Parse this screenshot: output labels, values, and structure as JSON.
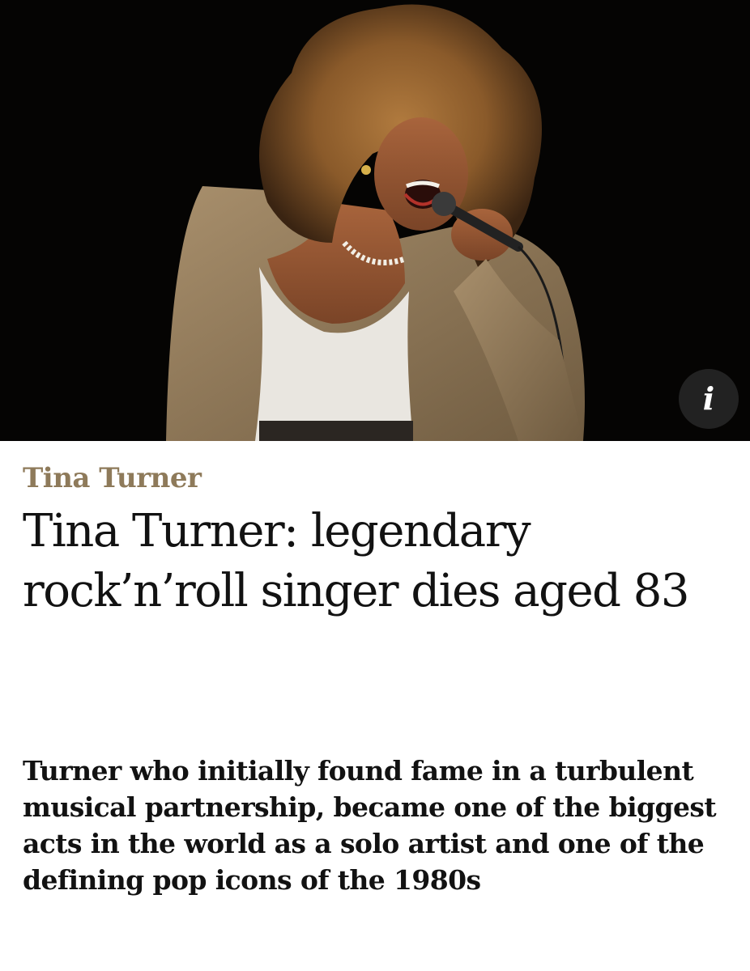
{
  "hero": {
    "info_label": "i"
  },
  "article": {
    "kicker": "Tina Turner",
    "headline": "Tina Turner: legendary rock’n’roll singer dies aged 83",
    "standfirst": "Turner who initially found fame in a turbulent musical partnership, became one of the biggest acts in the world as a solo artist and one of the defining pop icons of the 1980s"
  },
  "colors": {
    "kicker": "#8e7a5a",
    "text": "#121212",
    "hero_background": "#050403"
  }
}
